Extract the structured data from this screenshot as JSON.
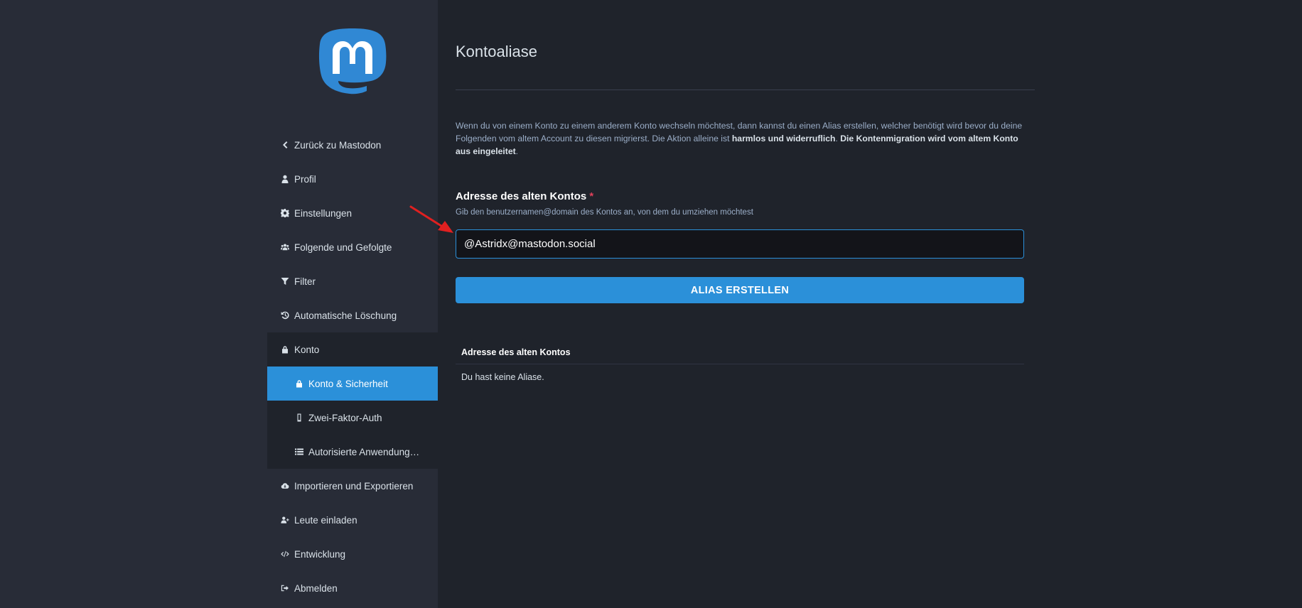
{
  "sidebar": {
    "items": [
      {
        "label": "Zurück zu Mastodon",
        "icon": "chevron-left-icon"
      },
      {
        "label": "Profil",
        "icon": "user-icon"
      },
      {
        "label": "Einstellungen",
        "icon": "gear-icon"
      },
      {
        "label": "Folgende und Gefolgte",
        "icon": "users-icon"
      },
      {
        "label": "Filter",
        "icon": "filter-icon"
      },
      {
        "label": "Automatische Löschung",
        "icon": "history-icon"
      },
      {
        "label": "Konto",
        "icon": "lock-icon"
      },
      {
        "label": "Importieren und Exportieren",
        "icon": "cloud-download-icon"
      },
      {
        "label": "Leute einladen",
        "icon": "user-plus-icon"
      },
      {
        "label": "Entwicklung",
        "icon": "code-icon"
      },
      {
        "label": "Abmelden",
        "icon": "sign-out-icon"
      }
    ],
    "subitems": [
      {
        "label": "Konto & Sicherheit",
        "icon": "lock-icon",
        "active": true
      },
      {
        "label": "Zwei-Faktor-Auth",
        "icon": "mobile-icon"
      },
      {
        "label": "Autorisierte Anwendung…",
        "icon": "list-icon"
      }
    ]
  },
  "main": {
    "title": "Kontoaliase",
    "intro_text": "Wenn du von einem Konto zu einem anderem Konto wechseln möchtest, dann kannst du einen Alias erstellen, welcher benötigt wird bevor du deine Folgenden vom altem Account zu diesen migrierst. Die Aktion alleine ist ",
    "intro_strong1": "harmlos und widerruflich",
    "intro_mid": ". ",
    "intro_strong2": "Die Kontenmigration wird vom altem Konto aus eingeleitet",
    "intro_end": ".",
    "field_label": "Adresse des alten Kontos",
    "required_mark": "*",
    "field_hint": "Gib den benutzernamen@domain des Kontos an, von dem du umziehen möchtest",
    "field_value": "@Astridx@mastodon.social",
    "submit_label": "ALIAS ERSTELLEN",
    "table_header": "Adresse des alten Kontos",
    "table_empty": "Du hast keine Aliase."
  },
  "colors": {
    "accent": "#2b90d9",
    "sidebar_bg": "#282c37",
    "content_bg": "#1f232b",
    "annotation_arrow": "#e02020"
  }
}
